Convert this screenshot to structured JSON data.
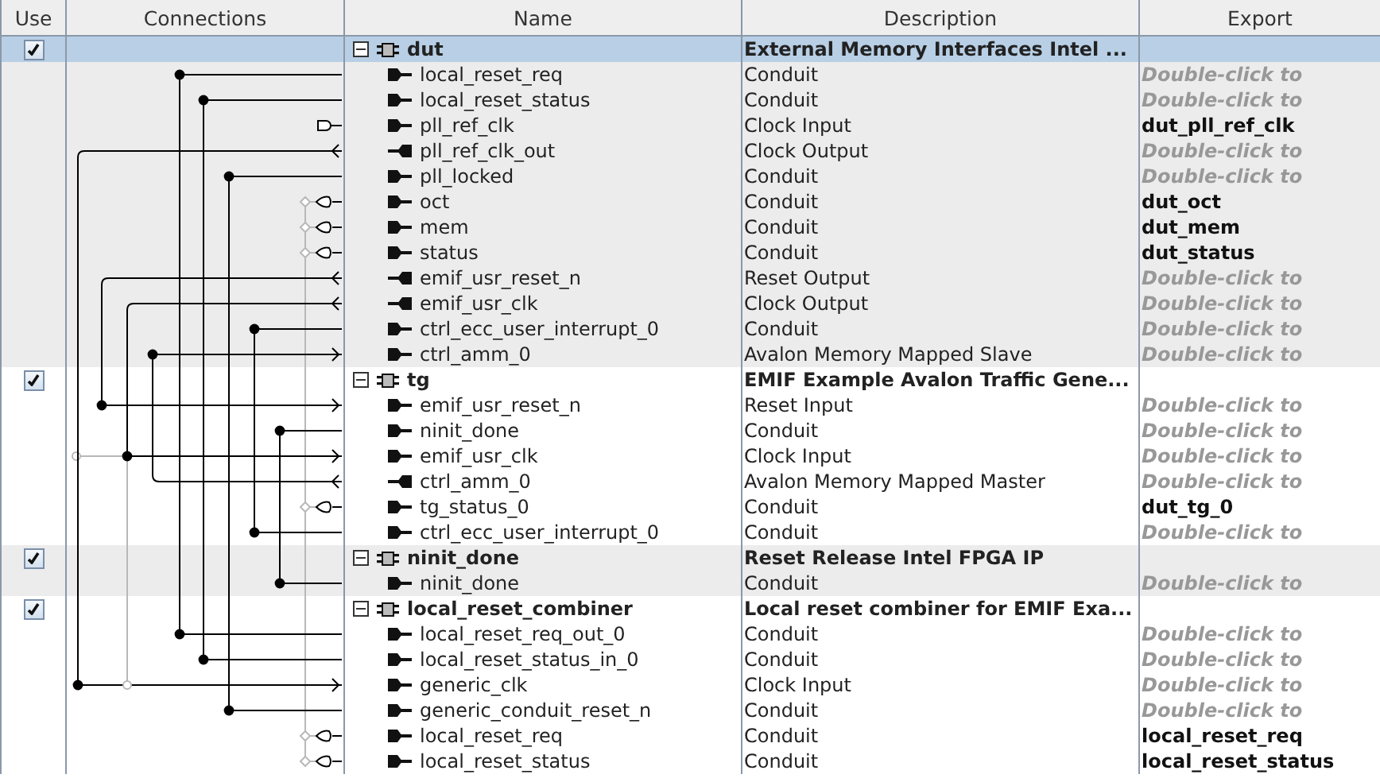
{
  "columns": [
    "Use",
    "Connections",
    "Name",
    "Description",
    "Export"
  ],
  "rows": [
    {
      "kind": "module",
      "name": "dut",
      "description": "External Memory Interfaces Intel ...",
      "checked": true,
      "expanded": true,
      "selected": true
    },
    {
      "kind": "interface",
      "name": "local_reset_req",
      "output": false,
      "description": "Conduit",
      "export": {
        "kind": "hint",
        "text": "Double-click to"
      }
    },
    {
      "kind": "interface",
      "name": "local_reset_status",
      "output": false,
      "description": "Conduit",
      "export": {
        "kind": "hint",
        "text": "Double-click to"
      }
    },
    {
      "kind": "interface",
      "name": "pll_ref_clk",
      "output": false,
      "description": "Clock Input",
      "export": {
        "kind": "name",
        "text": "dut_pll_ref_clk"
      }
    },
    {
      "kind": "interface",
      "name": "pll_ref_clk_out",
      "output": true,
      "description": "Clock Output",
      "export": {
        "kind": "hint",
        "text": "Double-click to"
      }
    },
    {
      "kind": "interface",
      "name": "pll_locked",
      "output": false,
      "description": "Conduit",
      "export": {
        "kind": "hint",
        "text": "Double-click to"
      }
    },
    {
      "kind": "interface",
      "name": "oct",
      "output": false,
      "description": "Conduit",
      "export": {
        "kind": "name",
        "text": "dut_oct"
      }
    },
    {
      "kind": "interface",
      "name": "mem",
      "output": false,
      "description": "Conduit",
      "export": {
        "kind": "name",
        "text": "dut_mem"
      }
    },
    {
      "kind": "interface",
      "name": "status",
      "output": false,
      "description": "Conduit",
      "export": {
        "kind": "name",
        "text": "dut_status"
      }
    },
    {
      "kind": "interface",
      "name": "emif_usr_reset_n",
      "output": true,
      "description": "Reset Output",
      "export": {
        "kind": "hint",
        "text": "Double-click to"
      }
    },
    {
      "kind": "interface",
      "name": "emif_usr_clk",
      "output": true,
      "description": "Clock Output",
      "export": {
        "kind": "hint",
        "text": "Double-click to"
      }
    },
    {
      "kind": "interface",
      "name": "ctrl_ecc_user_interrupt_0",
      "output": false,
      "description": "Conduit",
      "export": {
        "kind": "hint",
        "text": "Double-click to"
      }
    },
    {
      "kind": "interface",
      "name": "ctrl_amm_0",
      "output": false,
      "description": "Avalon Memory Mapped Slave",
      "export": {
        "kind": "hint",
        "text": "Double-click to"
      }
    },
    {
      "kind": "module",
      "name": "tg",
      "description": "EMIF Example Avalon Traffic Gene...",
      "checked": true,
      "expanded": true,
      "selected": false
    },
    {
      "kind": "interface",
      "name": "emif_usr_reset_n",
      "output": false,
      "description": "Reset Input",
      "export": {
        "kind": "hint",
        "text": "Double-click to"
      }
    },
    {
      "kind": "interface",
      "name": "ninit_done",
      "output": false,
      "description": "Conduit",
      "export": {
        "kind": "hint",
        "text": "Double-click to"
      }
    },
    {
      "kind": "interface",
      "name": "emif_usr_clk",
      "output": false,
      "description": "Clock Input",
      "export": {
        "kind": "hint",
        "text": "Double-click to"
      }
    },
    {
      "kind": "interface",
      "name": "ctrl_amm_0",
      "output": true,
      "description": "Avalon Memory Mapped Master",
      "export": {
        "kind": "hint",
        "text": "Double-click to"
      }
    },
    {
      "kind": "interface",
      "name": "tg_status_0",
      "output": false,
      "description": "Conduit",
      "export": {
        "kind": "name",
        "text": "dut_tg_0"
      }
    },
    {
      "kind": "interface",
      "name": "ctrl_ecc_user_interrupt_0",
      "output": false,
      "description": "Conduit",
      "export": {
        "kind": "hint",
        "text": "Double-click to"
      }
    },
    {
      "kind": "module",
      "name": "ninit_done",
      "description": "Reset Release Intel FPGA IP",
      "checked": true,
      "expanded": true,
      "selected": false
    },
    {
      "kind": "interface",
      "name": "ninit_done",
      "output": false,
      "description": "Conduit",
      "export": {
        "kind": "hint",
        "text": "Double-click to"
      }
    },
    {
      "kind": "module",
      "name": "local_reset_combiner",
      "description": "Local reset combiner for EMIF Exa...",
      "checked": true,
      "expanded": true,
      "selected": false
    },
    {
      "kind": "interface",
      "name": "local_reset_req_out_0",
      "output": false,
      "description": "Conduit",
      "export": {
        "kind": "hint",
        "text": "Double-click to"
      }
    },
    {
      "kind": "interface",
      "name": "local_reset_status_in_0",
      "output": false,
      "description": "Conduit",
      "export": {
        "kind": "hint",
        "text": "Double-click to"
      }
    },
    {
      "kind": "interface",
      "name": "generic_clk",
      "output": false,
      "description": "Clock Input",
      "export": {
        "kind": "hint",
        "text": "Double-click to"
      }
    },
    {
      "kind": "interface",
      "name": "generic_conduit_reset_n",
      "output": false,
      "description": "Conduit",
      "export": {
        "kind": "hint",
        "text": "Double-click to"
      }
    },
    {
      "kind": "interface",
      "name": "local_reset_req",
      "output": false,
      "description": "Conduit",
      "export": {
        "kind": "name",
        "text": "local_reset_req"
      }
    },
    {
      "kind": "interface",
      "name": "local_reset_status",
      "output": false,
      "description": "Conduit",
      "export": {
        "kind": "name",
        "text": "local_reset_status"
      }
    }
  ]
}
